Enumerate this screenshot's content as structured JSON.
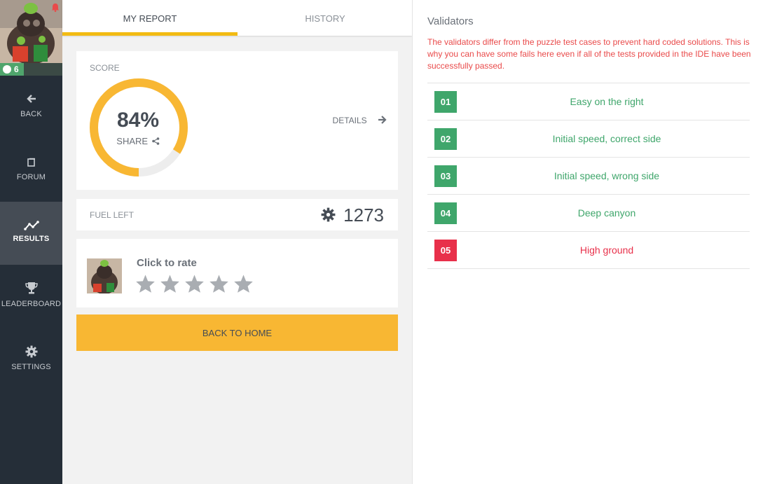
{
  "sidebar": {
    "notification_color": "#e94a4a",
    "level": "6",
    "items": [
      {
        "label": "BACK",
        "icon": "arrow-left-icon"
      },
      {
        "label": "FORUM",
        "icon": "forum-icon"
      },
      {
        "label": "RESULTS",
        "icon": "results-chart-icon",
        "active": true
      },
      {
        "label": "LEADERBOARD",
        "icon": "trophy-icon"
      },
      {
        "label": "SETTINGS",
        "icon": "gear-icon"
      }
    ]
  },
  "tabs": [
    {
      "label": "MY REPORT",
      "active": true
    },
    {
      "label": "HISTORY",
      "active": false
    }
  ],
  "report": {
    "score_label": "SCORE",
    "score_value": "84%",
    "score_fraction": 0.84,
    "share_label": "SHARE",
    "details_label": "DETAILS",
    "fuel_label": "FUEL LEFT",
    "fuel_value": "1273",
    "rate_title": "Click to rate",
    "star_count": 5,
    "back_home_label": "BACK TO HOME"
  },
  "validators": {
    "title": "Validators",
    "notice": "The validators differ from the puzzle test cases to prevent hard coded solutions. This is why you can have some fails here even if all of the tests provided in the IDE have been successfully passed.",
    "items": [
      {
        "id": "01",
        "name": "Easy on the right",
        "status": "pass"
      },
      {
        "id": "02",
        "name": "Initial speed, correct side",
        "status": "pass"
      },
      {
        "id": "03",
        "name": "Initial speed, wrong side",
        "status": "pass"
      },
      {
        "id": "04",
        "name": "Deep canyon",
        "status": "pass"
      },
      {
        "id": "05",
        "name": "High ground",
        "status": "fail"
      }
    ]
  },
  "colors": {
    "accent": "#f8b733",
    "pass": "#3fa66b",
    "fail": "#e8304a",
    "sidebar": "#252e38"
  }
}
